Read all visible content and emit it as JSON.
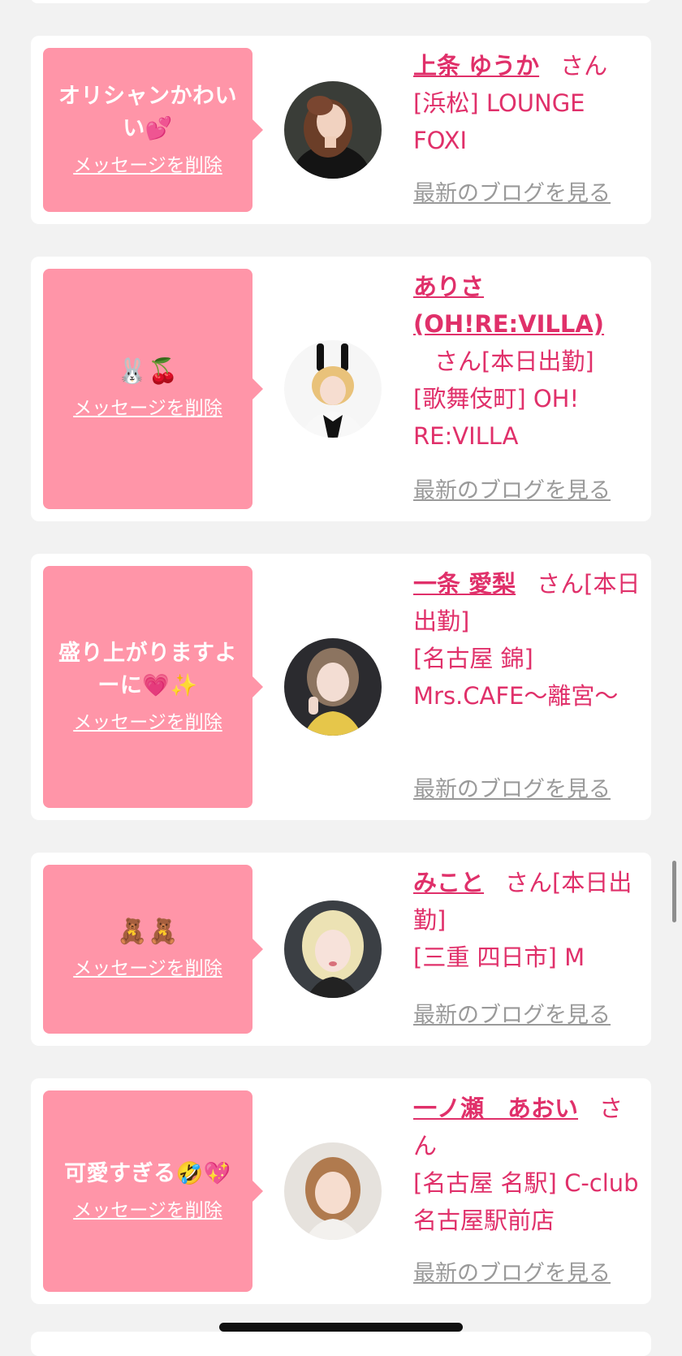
{
  "delete_label": "メッセージを削除",
  "blog_label": "最新のブログを見る",
  "san_label": "さん",
  "messages": [
    {
      "message": "オリシャンかわいい💕",
      "name": "上条 ゆうか",
      "status": "",
      "location": "[浜松] LOUNGE FOXI"
    },
    {
      "message": "🐰🍒",
      "name": "ありさ (OH!RE:VILLA)",
      "status": "[本日出勤]",
      "location": "[歌舞伎町] OH! RE:VILLA"
    },
    {
      "message": "盛り上がりますよーに💗✨",
      "name": "一条 愛梨",
      "status": "[本日出勤]",
      "location": "[名古屋 錦] Mrs.CAFE〜離宮〜"
    },
    {
      "message": "🧸🧸",
      "name": "みこと",
      "status": "[本日出勤]",
      "location": "[三重 四日市] M"
    },
    {
      "message": "可愛すぎる🤣💖",
      "name": "一ノ瀬　あおい",
      "status": "",
      "location": "[名古屋 名駅] C-club 名古屋駅前店"
    }
  ],
  "colors": {
    "bubble": "#ff95a8",
    "name": "#e0306a",
    "link_gray": "#9a9a9a",
    "background": "#f2f2f2"
  }
}
